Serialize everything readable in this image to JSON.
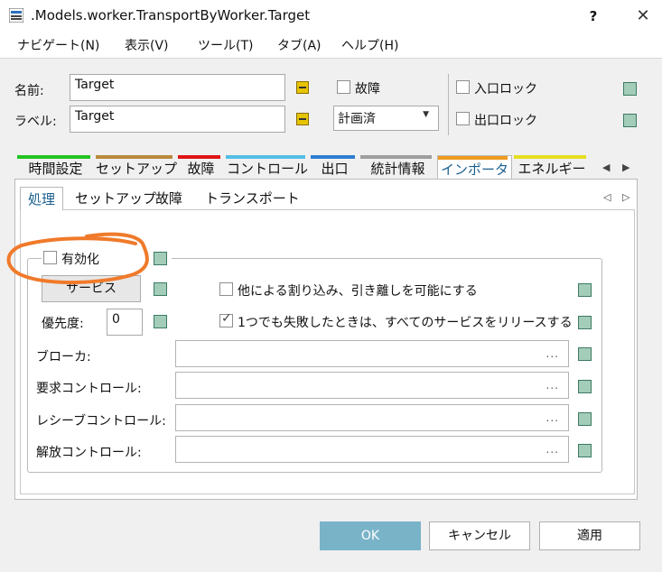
{
  "window": {
    "title": ".Models.worker.TransportByWorker.Target",
    "help_label": "?",
    "close_label": "✕"
  },
  "menu": {
    "items": [
      "ナビゲート(N)",
      "表示(V)",
      "ツール(T)",
      "タブ(A)",
      "ヘルプ(H)"
    ]
  },
  "header": {
    "name_label": "名前:",
    "name_value": "Target",
    "label_label": "ラベル:",
    "label_value": "Target",
    "failure_label": "故障",
    "plan_value": "計画済",
    "entrance_lock_label": "入口ロック",
    "exit_lock_label": "出口ロック"
  },
  "tabs": [
    {
      "label": "時間設定",
      "color": "#22c322"
    },
    {
      "label": "セットアップ",
      "color": "#b98a3c"
    },
    {
      "label": "故障",
      "color": "#e01515"
    },
    {
      "label": "コントロール",
      "color": "#52bde6"
    },
    {
      "label": "出口",
      "color": "#2f7dd1"
    },
    {
      "label": "統計情報",
      "color": "#9e9e9e"
    },
    {
      "label": "インポータ",
      "color": "#f09a1f"
    },
    {
      "label": "エネルギー",
      "color": "#e6dd20"
    }
  ],
  "subtabs": [
    "処理",
    "セットアップ",
    "故障",
    "トランスポート"
  ],
  "importer": {
    "enabled_label": "有効化",
    "enabled_checked": false,
    "service_button": "サービス",
    "priority_label": "優先度:",
    "priority_value": "0",
    "allow_interrupt_label": "他による割り込み、引き離しを可能にする",
    "allow_interrupt_checked": false,
    "release_all_label": "1つでも失敗したときは、すべてのサービスをリリースする",
    "release_all_checked": true,
    "fields": [
      {
        "label": "ブローカ:",
        "value": ""
      },
      {
        "label": "要求コントロール:",
        "value": ""
      },
      {
        "label": "レシーブコントロール:",
        "value": ""
      },
      {
        "label": "解放コントロール:",
        "value": ""
      }
    ],
    "dots": "..."
  },
  "footer": {
    "ok": "OK",
    "cancel": "キャンセル",
    "apply": "適用"
  },
  "colors": {
    "accent": "#79b3c8",
    "annotation": "#f07a2a"
  }
}
